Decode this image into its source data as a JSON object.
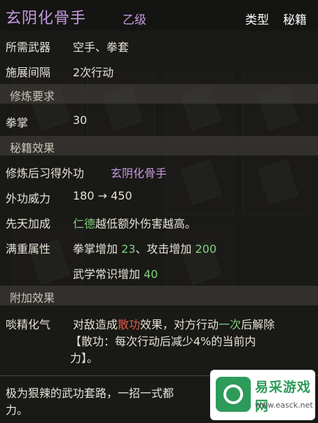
{
  "header": {
    "title": "玄阴化骨手",
    "grade": "乙级",
    "type_label": "类型",
    "type_value": "秘籍"
  },
  "requirements": {
    "weapon_label": "所需武器",
    "weapon_value": "空手、拳套",
    "interval_label": "施展间隔",
    "interval_value": "2次行动"
  },
  "practice_section": {
    "title": "修炼要求",
    "skill_label": "拳掌",
    "skill_value": "30"
  },
  "effect_section": {
    "title": "秘籍效果",
    "gain_label": "修炼后习得外功",
    "gain_value": "玄阴化骨手",
    "power_label": "外功威力",
    "power_value": "180 → 450",
    "innate_label": "先天加成",
    "innate_highlight": "仁德",
    "innate_text": "越低额外伤害越高。",
    "full_label": "满重属性",
    "full_line1_a": "拳掌增加",
    "full_line1_a_val": "23",
    "full_line1_sep": "、攻击增加",
    "full_line1_b_val": "200",
    "full_line2_a": "武学常识增加",
    "full_line2_a_val": "40"
  },
  "extra_section": {
    "title": "附加效果",
    "label": "啖精化气",
    "line1_a": "对敌造成",
    "line1_red": "散功",
    "line1_b": "效果，对方行动",
    "line1_green": "一次",
    "line1_c": "后解除",
    "line2": "【散功：每次行动后减少4%的当前内",
    "line3": "力】。"
  },
  "footer": {
    "line1": "极为狠辣的武功套路，一招一式都",
    "line2": "力。"
  },
  "watermark": {
    "name": "易采游戏网",
    "url": "www.easck.net",
    "gd": "GD游戏"
  },
  "colors": {
    "purple": "#c59be0",
    "green": "#7fd07f",
    "red": "#e05a4a"
  }
}
